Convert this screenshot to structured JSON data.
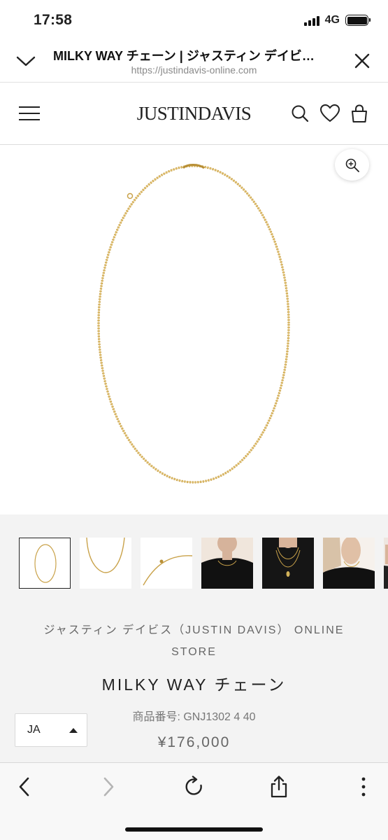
{
  "status_bar": {
    "time": "17:58",
    "network": "4G"
  },
  "browser": {
    "page_title": "MILKY WAY チェーン | ジャスティン デイビ…",
    "url": "https://justindavis-online.com"
  },
  "site": {
    "logo": "JUSTINDAVIS"
  },
  "product": {
    "brand_line": "ジャスティン デイビス（JUSTIN DAVIS） ONLINE STORE",
    "name": "MILKY WAY チェーン",
    "sku": "商品番号: GNJ1302 4 40",
    "price": "¥176,000",
    "thumbnails": [
      {
        "kind": "chain-full",
        "selected": true
      },
      {
        "kind": "chain-closeup",
        "selected": false
      },
      {
        "kind": "clasp-detail",
        "selected": false
      },
      {
        "kind": "model-neck",
        "selected": false
      },
      {
        "kind": "model-layered",
        "selected": false
      },
      {
        "kind": "model-woman",
        "selected": false
      },
      {
        "kind": "model-partial",
        "selected": false
      }
    ]
  },
  "language_select": {
    "value": "JA"
  },
  "icons": {
    "collapse": "chevron-down-icon",
    "close": "close-icon",
    "menu": "hamburger-menu-icon",
    "search": "search-icon",
    "wishlist": "heart-icon",
    "cart": "shopping-bag-icon",
    "zoom": "zoom-in-icon",
    "back": "back-arrow-icon",
    "forward": "forward-arrow-icon",
    "reload": "reload-icon",
    "share": "share-icon",
    "more": "more-icon"
  },
  "colors": {
    "gold": "#c9a24a",
    "info_bg": "#f3f3f3"
  }
}
